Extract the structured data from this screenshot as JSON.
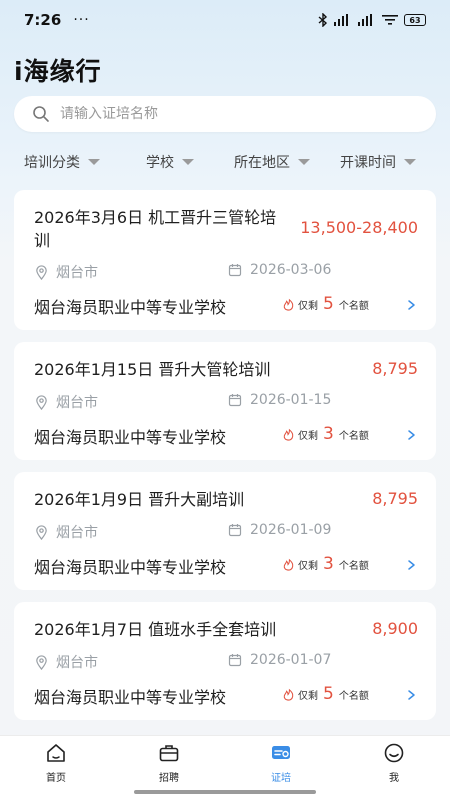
{
  "status_bar": {
    "time": "7:26",
    "dots": "···",
    "battery": "63"
  },
  "app_title": "i海缘行",
  "search": {
    "placeholder": "请输入证培名称"
  },
  "filters": [
    "培训分类",
    "学校",
    "所在地区",
    "开课时间"
  ],
  "remaining_prefix": "仅剩",
  "remaining_suffix": "个名额",
  "courses": [
    {
      "title": "2026年3月6日 机工晋升三管轮培训",
      "price": "13,500-28,400",
      "city": "烟台市",
      "date": "2026-03-06",
      "school": "烟台海员职业中等专业学校",
      "remaining": "5"
    },
    {
      "title": "2026年1月15日 晋升大管轮培训",
      "price": "8,795",
      "city": "烟台市",
      "date": "2026-01-15",
      "school": "烟台海员职业中等专业学校",
      "remaining": "3"
    },
    {
      "title": "2026年1月9日 晋升大副培训",
      "price": "8,795",
      "city": "烟台市",
      "date": "2026-01-09",
      "school": "烟台海员职业中等专业学校",
      "remaining": "3"
    },
    {
      "title": "2026年1月7日 值班水手全套培训",
      "price": "8,900",
      "city": "烟台市",
      "date": "2026-01-07",
      "school": "烟台海员职业中等专业学校",
      "remaining": "5"
    }
  ],
  "tabs": [
    {
      "label": "首页",
      "icon": "home-icon",
      "active": false
    },
    {
      "label": "招聘",
      "icon": "briefcase-icon",
      "active": false
    },
    {
      "label": "证培",
      "icon": "certificate-icon",
      "active": true
    },
    {
      "label": "我",
      "icon": "smile-icon",
      "active": false
    }
  ],
  "colors": {
    "accent": "#3a8de6",
    "price": "#e2523f"
  }
}
